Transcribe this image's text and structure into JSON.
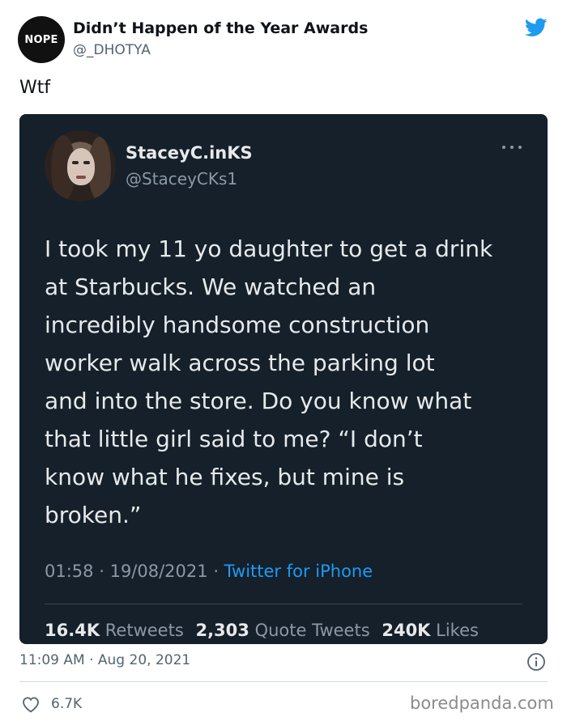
{
  "header": {
    "avatar_text": "NOPE",
    "account_name": "Didn’t Happen of the Year Awards",
    "account_handle": "@_DHOTYA",
    "logo_icon": "twitter-bird-icon",
    "logo_color": "#1d9bf0"
  },
  "tweet": {
    "text": "Wtf",
    "timestamp": "11:09 AM · Aug 20, 2021",
    "info_icon": "info-icon",
    "likes_icon": "heart-icon",
    "likes_count": "6.7K"
  },
  "quoted": {
    "background": "#15202b",
    "name": "StaceyC.inKS",
    "handle": "@StaceyCKs1",
    "menu_icon": "more-options-icon",
    "body": "I took my 11 yo daughter to get a drink\nat Starbucks. We watched an\nincredibly handsome construction\nworker walk across the parking lot\nand into the store. Do you know what\nthat little girl said to me? “I don’t\nknow what he fixes, but mine is\nbroken.”",
    "time": "01:58",
    "date": "19/08/2021",
    "source": "Twitter for iPhone",
    "source_color": "#1d9bf0",
    "stats": {
      "retweets_count": "16.4K",
      "retweets_label": "Retweets",
      "quotes_count": "2,303",
      "quotes_label": "Quote Tweets",
      "likes_count": "240K",
      "likes_label": "Likes"
    }
  },
  "watermark": "boredpanda.com"
}
